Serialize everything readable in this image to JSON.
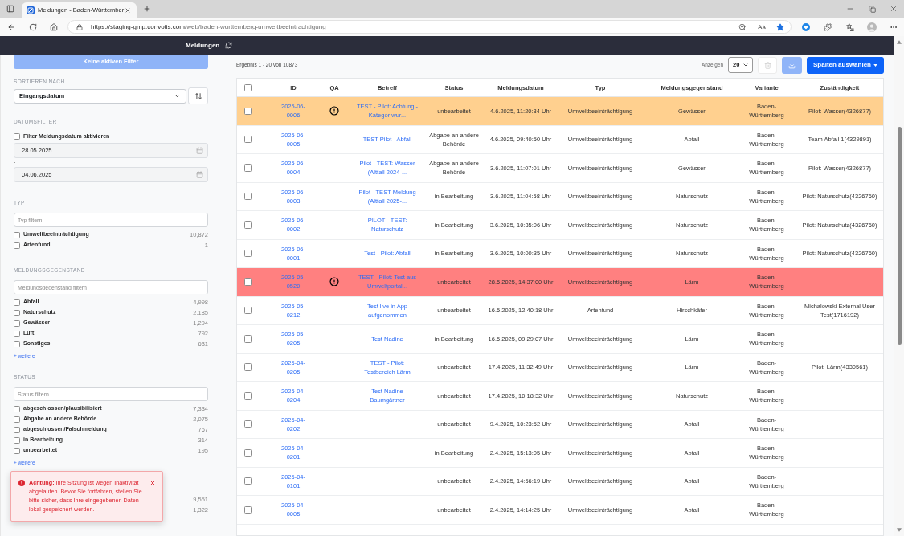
{
  "browser": {
    "tab_title": "Meldungen - Baden-Württember",
    "url_host": "https://staging-gmp.convotis.com",
    "url_path": "/web/baden-wurttemberg-umweltbeeintrachtigung"
  },
  "app_header": {
    "title": "Meldungen"
  },
  "sidebar": {
    "clear_filters": {
      "label": "Keine aktiven Filter",
      "disabled": true
    },
    "sort": {
      "heading": "SORTIEREN NACH",
      "value": "Eingangsdatum"
    },
    "date_filter": {
      "heading": "DATUMSFILTER",
      "enable": {
        "label": "Filter Meldungsdatum aktivieren",
        "checked": false
      },
      "from": "28.05.2025",
      "separator": "-",
      "to": "04.06.2025"
    },
    "sections": [
      {
        "heading": "TYP",
        "placeholder": "Typ filtern",
        "options": [
          {
            "label": "Umweltbeeinträchtigung",
            "count": "10,872",
            "checked": false
          },
          {
            "label": "Artenfund",
            "count": "1",
            "checked": false
          }
        ]
      },
      {
        "heading": "MELDUNGSGEGENSTAND",
        "placeholder": "Meldungsgegenstand filtern",
        "options": [
          {
            "label": "Abfall",
            "count": "4,998",
            "checked": false
          },
          {
            "label": "Naturschutz",
            "count": "2,185",
            "checked": false
          },
          {
            "label": "Gewässer",
            "count": "1,294",
            "checked": false
          },
          {
            "label": "Luft",
            "count": "792",
            "checked": false
          },
          {
            "label": "Sonstiges",
            "count": "631",
            "checked": false
          }
        ],
        "more_link": "+ weitere"
      },
      {
        "heading": "STATUS",
        "placeholder": "Status filtern",
        "options": [
          {
            "label": "abgeschlossen/plausibilisiert",
            "count": "7,334",
            "checked": false
          },
          {
            "label": "Abgabe an andere Behörde",
            "count": "2,075",
            "checked": false
          },
          {
            "label": "abgeschlossen/Falschmeldung",
            "count": "767",
            "checked": false
          },
          {
            "label": "in Bearbeitung",
            "count": "314",
            "checked": false
          },
          {
            "label": "unbearbeitet",
            "count": "195",
            "checked": false
          }
        ],
        "more_link": "+ weitere"
      },
      {
        "options": [
          {
            "count": "9,551"
          },
          {
            "count": "1,322"
          }
        ]
      }
    ]
  },
  "toast": {
    "text": "**Achtung:** Ihre Sitzung ist wegen Inaktivität abgelaufen. Bevor Sie fortfahren, stellen Sie bitte sicher, dass Ihre eingegebenen Daten lokal gespeichert werden."
  },
  "results": {
    "summary": "Ergebnis 1 - 20 von 10873",
    "page_size_label": "Anzeigen",
    "page_size": "20",
    "delete_button": {
      "disabled": true
    },
    "download_button": {
      "disabled": true
    },
    "columns_button": "Spalten auswählen"
  },
  "table": {
    "select_all": {
      "checked": false
    },
    "columns": [
      "ID",
      "QA",
      "Betreff",
      "Status",
      "Meldungsdatum",
      "Typ",
      "Meldungsgegenstand",
      "Variante",
      "Zuständigkeit"
    ],
    "rows": [
      {
        "checked": false,
        "color": "#ffd08f",
        "id": "2025-06-0006",
        "qa_alert": true,
        "subject": "TEST - Pilot: Achtung - Kategor wur...",
        "status": "unbearbeitet",
        "reported_at": "4.6.2025, 11:20:34 Uhr",
        "type": "Umweltbeeinträchtigung",
        "category": "Gewässer",
        "variant": "Baden-Württemberg",
        "responsible": "Pilot: Wasser(4326877)"
      },
      {
        "checked": false,
        "color": "#ffffff",
        "id": "2025-06-0005",
        "qa_alert": false,
        "subject": "TEST Pilot - Abfall",
        "status": "Abgabe an andere Behörde",
        "reported_at": "4.6.2025, 09:40:50 Uhr",
        "type": "Umweltbeeinträchtigung",
        "category": "Abfall",
        "variant": "Baden-Württemberg",
        "responsible": "Team Abfall 1(4329891)"
      },
      {
        "checked": false,
        "color": "#ffffff",
        "id": "2025-06-0004",
        "qa_alert": false,
        "subject": "Pilot - TEST: Wasser (Altfall 2024-...",
        "status": "Abgabe an andere Behörde",
        "reported_at": "3.6.2025, 11:07:01 Uhr",
        "type": "Umweltbeeinträchtigung",
        "category": "Gewässer",
        "variant": "Baden-Württemberg",
        "responsible": "Pilot: Wasser(4326877)"
      },
      {
        "checked": false,
        "color": "#ffffff",
        "id": "2025-06-0003",
        "qa_alert": false,
        "subject": "Pilot - TEST-Meldung (Altfall 2025-...",
        "status": "in Bearbeitung",
        "reported_at": "3.6.2025, 11:04:58 Uhr",
        "type": "Umweltbeeinträchtigung",
        "category": "Naturschutz",
        "variant": "Baden-Württemberg",
        "responsible": "Pilot: Naturschutz(4326760)"
      },
      {
        "checked": false,
        "color": "#ffffff",
        "id": "2025-06-0002",
        "qa_alert": false,
        "subject": "PILOT - TEST: Naturschutz",
        "status": "in Bearbeitung",
        "reported_at": "3.6.2025, 10:35:06 Uhr",
        "type": "Umweltbeeinträchtigung",
        "category": "Naturschutz",
        "variant": "Baden-Württemberg",
        "responsible": "Pilot: Naturschutz(4326760)"
      },
      {
        "checked": false,
        "color": "#ffffff",
        "id": "2025-06-0001",
        "qa_alert": false,
        "subject": "Test - Pilot: Abfall",
        "status": "in Bearbeitung",
        "reported_at": "3.6.2025, 10:00:35 Uhr",
        "type": "Umweltbeeinträchtigung",
        "category": "Naturschutz",
        "variant": "Baden-Württemberg",
        "responsible": "Pilot: Naturschutz(4326760)"
      },
      {
        "checked": false,
        "color": "#ff8080",
        "id": "2025-05-0520",
        "qa_alert": true,
        "subject": "TEST - Pilot: Test aus Umweltportal...",
        "status": "unbearbeitet",
        "reported_at": "28.5.2025, 14:37:00 Uhr",
        "type": "Umweltbeeinträchtigung",
        "category": "Lärm",
        "variant": "Baden-Württemberg"
      },
      {
        "checked": false,
        "color": "#ffffff",
        "id": "2025-05-0212",
        "qa_alert": false,
        "subject": "Test live in App aufgenommen",
        "status": "unbearbeitet",
        "reported_at": "16.5.2025, 12:40:18 Uhr",
        "type": "Artenfund",
        "category": "Hirschkäfer",
        "variant": "Baden-Württemberg",
        "responsible": "Michalowski External User Test(1716192)"
      },
      {
        "checked": false,
        "color": "#ffffff",
        "id": "2025-05-0205",
        "qa_alert": false,
        "subject": "Test Nadine",
        "status": "in Bearbeitung",
        "reported_at": "16.5.2025, 09:29:07 Uhr",
        "type": "Umweltbeeinträchtigung",
        "category": "Lärm",
        "variant": "Baden-Württemberg"
      },
      {
        "checked": false,
        "color": "#ffffff",
        "id": "2025-04-0205",
        "qa_alert": false,
        "subject": "TEST - Pilot: Testbereich Lärm",
        "status": "unbearbeitet",
        "reported_at": "17.4.2025, 11:32:49 Uhr",
        "type": "Umweltbeeinträchtigung",
        "category": "Lärm",
        "variant": "Baden-Württemberg",
        "responsible": "Pilot: Lärm(4330561)"
      },
      {
        "checked": false,
        "color": "#ffffff",
        "id": "2025-04-0204",
        "qa_alert": false,
        "subject": "Test Nadine Baumgärtner",
        "status": "unbearbeitet",
        "reported_at": "17.4.2025, 10:18:32 Uhr",
        "type": "Umweltbeeinträchtigung",
        "category": "Naturschutz",
        "variant": "Baden-Württemberg"
      },
      {
        "checked": false,
        "color": "#ffffff",
        "id": "2025-04-0202",
        "qa_alert": false,
        "status": "unbearbeitet",
        "reported_at": "9.4.2025, 10:23:52 Uhr",
        "type": "Umweltbeeinträchtigung",
        "category": "Abfall",
        "variant": "Baden-Württemberg"
      },
      {
        "checked": false,
        "color": "#ffffff",
        "id": "2025-04-0201",
        "qa_alert": false,
        "status": "in Bearbeitung",
        "reported_at": "2.4.2025, 15:13:05 Uhr",
        "type": "Umweltbeeinträchtigung",
        "category": "Abfall",
        "variant": "Baden-Württemberg"
      },
      {
        "checked": false,
        "color": "#ffffff",
        "id": "2025-04-0101",
        "qa_alert": false,
        "status": "unbearbeitet",
        "reported_at": "2.4.2025, 14:56:19 Uhr",
        "type": "Umweltbeeinträchtigung",
        "category": "Abfall",
        "variant": "Baden-Württemberg"
      },
      {
        "checked": false,
        "color": "#ffffff",
        "id": "2025-04-0005",
        "qa_alert": false,
        "status": "unbearbeitet",
        "reported_at": "2.4.2025, 14:14:25 Uhr",
        "type": "Umweltbeeinträchtigung",
        "category": "Abfall",
        "variant": "Baden-Württemberg"
      }
    ]
  }
}
